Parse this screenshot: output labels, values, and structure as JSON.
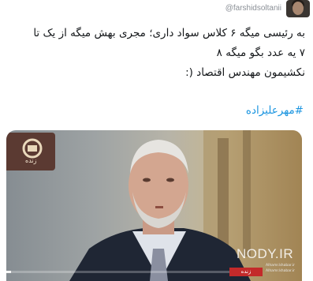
{
  "tweet": {
    "handle": "@farshidsoltanii",
    "lines": [
      "به رئیسی میگه ۶ کلاس سواد داری؛ مجری بهش میگه از یک تا",
      "۷ یه عدد بگو میگه ۸",
      "نکشیمون مهندس اقتصاد (:"
    ],
    "hashtag": "#مهرعلیزاده"
  },
  "video": {
    "channel_name": "زنده",
    "badge_label": "زنده",
    "caption_small": [
      "Alhamr.khabar.ir",
      "Alhamr.khabar.ir"
    ],
    "watermark": "NODY.IR",
    "progress_fraction": 0.02
  },
  "colors": {
    "link": "#1b95e0",
    "text": "#14171a",
    "muted": "#8a8f96",
    "badge": "#c32a2a"
  }
}
